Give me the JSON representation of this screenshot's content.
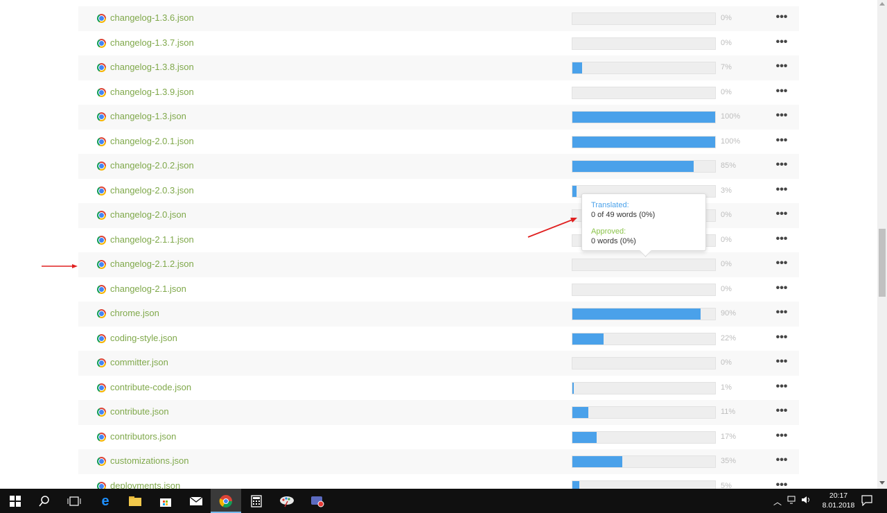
{
  "files": [
    {
      "name": "changelog-1.3.6.json",
      "progress": 0,
      "percent_label": "0%"
    },
    {
      "name": "changelog-1.3.7.json",
      "progress": 0,
      "percent_label": "0%"
    },
    {
      "name": "changelog-1.3.8.json",
      "progress": 7,
      "percent_label": "7%"
    },
    {
      "name": "changelog-1.3.9.json",
      "progress": 0,
      "percent_label": "0%"
    },
    {
      "name": "changelog-1.3.json",
      "progress": 100,
      "percent_label": "100%"
    },
    {
      "name": "changelog-2.0.1.json",
      "progress": 100,
      "percent_label": "100%"
    },
    {
      "name": "changelog-2.0.2.json",
      "progress": 85,
      "percent_label": "85%"
    },
    {
      "name": "changelog-2.0.3.json",
      "progress": 3,
      "percent_label": "3%"
    },
    {
      "name": "changelog-2.0.json",
      "progress": 0,
      "percent_label": "0%"
    },
    {
      "name": "changelog-2.1.1.json",
      "progress": 0,
      "percent_label": "0%"
    },
    {
      "name": "changelog-2.1.2.json",
      "progress": 0,
      "percent_label": "0%"
    },
    {
      "name": "changelog-2.1.json",
      "progress": 0,
      "percent_label": "0%"
    },
    {
      "name": "chrome.json",
      "progress": 90,
      "percent_label": "90%"
    },
    {
      "name": "coding-style.json",
      "progress": 22,
      "percent_label": "22%"
    },
    {
      "name": "committer.json",
      "progress": 0,
      "percent_label": "0%"
    },
    {
      "name": "contribute-code.json",
      "progress": 1,
      "percent_label": "1%"
    },
    {
      "name": "contribute.json",
      "progress": 11,
      "percent_label": "11%"
    },
    {
      "name": "contributors.json",
      "progress": 17,
      "percent_label": "17%"
    },
    {
      "name": "customizations.json",
      "progress": 35,
      "percent_label": "35%"
    },
    {
      "name": "deployments.json",
      "progress": 5,
      "percent_label": "5%"
    }
  ],
  "row_menu_label": "•••",
  "tooltip": {
    "translated_label": "Translated:",
    "translated_value": "0 of 49 words (0%)",
    "approved_label": "Approved:",
    "approved_value": "0 words (0%)"
  },
  "taskbar": {
    "time": "20:17",
    "date": "8.01.2018",
    "icons": [
      "windows-start-icon",
      "search-icon",
      "task-view-icon",
      "edge-icon",
      "file-explorer-icon",
      "store-icon",
      "mail-icon",
      "chrome-icon",
      "calculator-icon",
      "paint-icon",
      "screen-recorder-icon"
    ]
  },
  "colors": {
    "link": "#7fa84a",
    "bar_fill": "#4aa1ea",
    "annotation_arrow": "#e02020"
  }
}
